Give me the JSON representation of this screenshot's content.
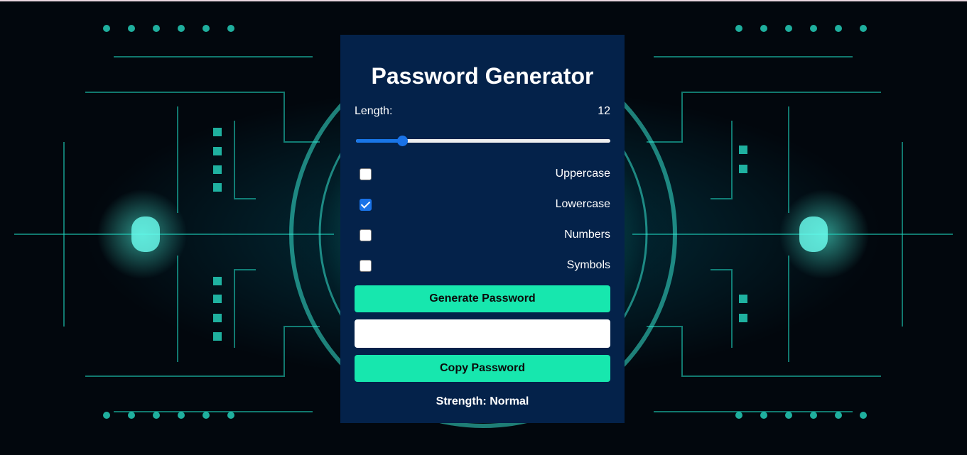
{
  "app": {
    "title": "Password Generator"
  },
  "length": {
    "label": "Length:",
    "value": "12",
    "slider_fraction": 0.17
  },
  "options": [
    {
      "label": "Uppercase",
      "checked": false
    },
    {
      "label": "Lowercase",
      "checked": true
    },
    {
      "label": "Numbers",
      "checked": false
    },
    {
      "label": "Symbols",
      "checked": false
    }
  ],
  "buttons": {
    "generate_label": "Generate Password",
    "copy_label": "Copy Password"
  },
  "output": {
    "value": ""
  },
  "strength": {
    "text": "Strength: Normal"
  },
  "colors": {
    "card_background": "#04224a",
    "button_accent": "#17e7ae",
    "slider_accent": "#1a73e8",
    "background_glow": "#28e6c8"
  },
  "icons": {
    "checked_box": "checkmark-icon"
  }
}
